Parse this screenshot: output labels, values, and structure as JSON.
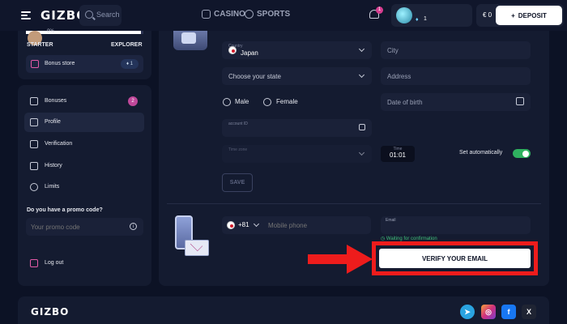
{
  "header": {
    "logo": "GIZBO",
    "search_placeholder": "Search",
    "nav": [
      {
        "label": "CASINO"
      },
      {
        "label": "SPORTS"
      }
    ],
    "notifications_count": "1",
    "level": "1",
    "balance": "€ 0",
    "deposit_label": "DEPOSIT"
  },
  "progress": {
    "percent_label": "0%",
    "fraction": 0.98,
    "from_level": "STARTER",
    "to_level": "EXPLORER"
  },
  "bonus_store": {
    "label": "Bonus store",
    "badge": "1"
  },
  "sidebar": {
    "items": [
      {
        "label": "Bonuses",
        "count": "2"
      },
      {
        "label": "Profile"
      },
      {
        "label": "Verification"
      },
      {
        "label": "History"
      },
      {
        "label": "Limits"
      }
    ],
    "promo_title": "Do you have a promo code?",
    "promo_placeholder": "Your promo code",
    "logout_label": "Log out"
  },
  "form": {
    "country_label": "Country",
    "country_value": "Japan",
    "city_placeholder": "City",
    "state_placeholder": "Choose your state",
    "address_placeholder": "Address",
    "gender_male": "Male",
    "gender_female": "Female",
    "dob_placeholder": "Date of birth",
    "account_id_label": "account ID",
    "timezone_label": "Time zone",
    "time_label": "Time",
    "time_value": "01:01",
    "set_auto_label": "Set automatically",
    "set_auto_on": true,
    "save_label": "SAVE"
  },
  "contact": {
    "phone_code": "+81",
    "phone_placeholder": "Mobile phone",
    "email_label": "Email",
    "waiting_label": "Waiting for confirmation",
    "verify_label": "VERIFY YOUR EMAIL"
  },
  "footer": {
    "logo": "GIZBO",
    "social": [
      {
        "name": "telegram-icon",
        "color": "#2aa3e0"
      },
      {
        "name": "instagram-icon",
        "color": "#d0307c"
      },
      {
        "name": "facebook-icon",
        "color": "#1877f2"
      },
      {
        "name": "x-icon",
        "color": "#1f2433"
      }
    ]
  },
  "colors": {
    "annotation_red": "#ee1c1c",
    "toggle_on": "#2fb15f",
    "accent_pink": "#c0489a"
  }
}
